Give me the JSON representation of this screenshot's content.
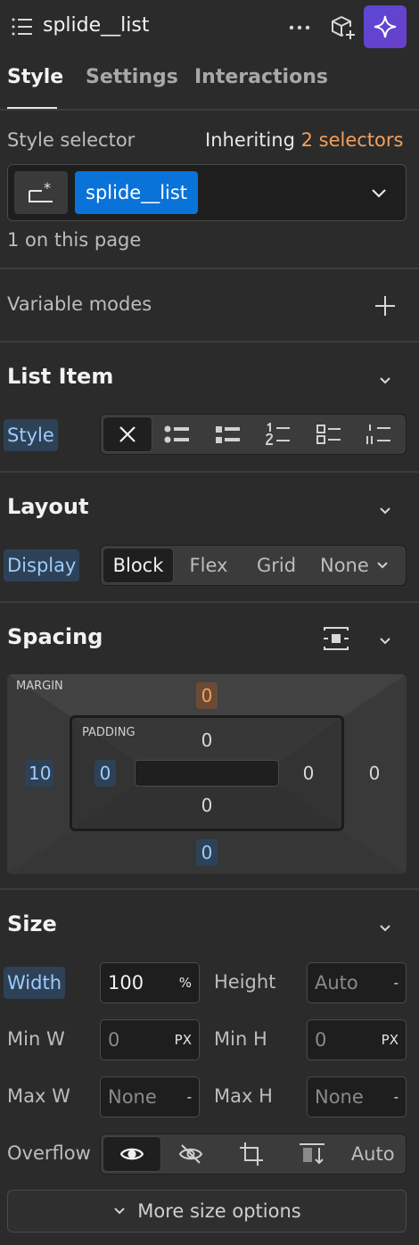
{
  "header": {
    "element_name": "splide__list",
    "icons": [
      "list-icon",
      "more-icon",
      "component-add-icon",
      "ai-sparkle-icon"
    ]
  },
  "tabs": [
    {
      "label": "Style",
      "active": true
    },
    {
      "label": "Settings",
      "active": false
    },
    {
      "label": "Interactions",
      "active": false
    }
  ],
  "selector": {
    "label": "Style selector",
    "inheriting_prefix": "Inheriting",
    "inheriting_count": "2 selectors",
    "class_chip": "splide__list",
    "page_count": "1 on this page"
  },
  "variable_modes": {
    "label": "Variable modes"
  },
  "list_item": {
    "title": "List Item",
    "style_label": "Style",
    "options": [
      "none-icon",
      "bullet-disc-icon",
      "bullet-square-icon",
      "numbered-list-icon",
      "checklist-icon",
      "roman-list-icon"
    ]
  },
  "layout": {
    "title": "Layout",
    "display_label": "Display",
    "options": [
      "Block",
      "Flex",
      "Grid",
      "None"
    ],
    "active": "Block"
  },
  "spacing": {
    "title": "Spacing",
    "margin_label": "MARGIN",
    "padding_label": "PADDING",
    "margin": {
      "top": "0",
      "right": "0",
      "bottom": "0",
      "left": "10"
    },
    "padding": {
      "top": "0",
      "right": "0",
      "bottom": "0",
      "left": "0"
    }
  },
  "size": {
    "title": "Size",
    "width_label": "Width",
    "width_value": "100",
    "width_unit": "%",
    "height_label": "Height",
    "height_value": "Auto",
    "height_unit": "-",
    "min_w_label": "Min W",
    "min_w_value": "0",
    "min_w_unit": "PX",
    "min_h_label": "Min H",
    "min_h_value": "0",
    "min_h_unit": "PX",
    "max_w_label": "Max W",
    "max_w_value": "None",
    "max_w_unit": "-",
    "max_h_label": "Max H",
    "max_h_value": "None",
    "max_h_unit": "-",
    "overflow_label": "Overflow",
    "overflow_auto": "Auto",
    "more_options": "More size options"
  },
  "colors": {
    "accent_blue": "#0a73d9",
    "label_bound_bg": "#2e4257",
    "label_bound_text": "#9ccbff",
    "inherit_orange": "#f5a05a",
    "panel_bg": "#2b2b2b"
  }
}
